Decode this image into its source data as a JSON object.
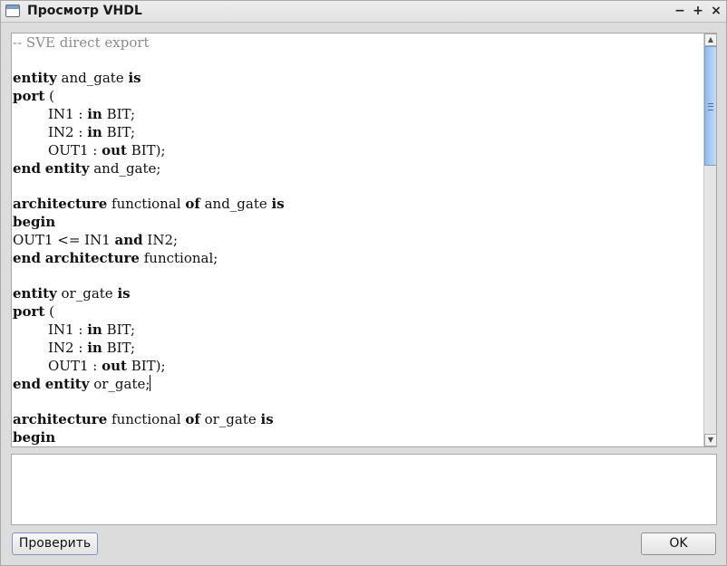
{
  "window": {
    "title": "Просмотр VHDL",
    "controls": {
      "minimize": "−",
      "maximize": "+",
      "close": "×"
    }
  },
  "editor": {
    "comment": "-- SVE direct export",
    "entity1": {
      "kw_entity": "entity",
      "name": "and_gate",
      "kw_is": "is"
    },
    "port1": {
      "kw_port": "port",
      "paren": " (",
      "lines": [
        {
          "sig": "IN1 : ",
          "kw": "in",
          "type": " BIT;"
        },
        {
          "sig": "IN2 : ",
          "kw": "in",
          "type": " BIT;"
        },
        {
          "sig": "OUT1 : ",
          "kw": "out",
          "type": " BIT);"
        }
      ]
    },
    "end_entity1": {
      "kw_end": "end",
      "kw_entity": "entity",
      "name": "and_gate;"
    },
    "arch1": {
      "kw_arch": "architecture",
      "name": "functional",
      "kw_of": "of",
      "target": "and_gate",
      "kw_is": "is"
    },
    "begin1": "begin",
    "assign1": {
      "lhs": "OUT1 <= IN1 ",
      "op": "and",
      "rhs": " IN2;"
    },
    "end_arch1": {
      "kw_end": "end",
      "kw_arch": "architecture",
      "name": "functional;"
    },
    "entity2": {
      "kw_entity": "entity",
      "name": "or_gate",
      "kw_is": "is"
    },
    "port2": {
      "kw_port": "port",
      "paren": " (",
      "lines": [
        {
          "sig": "IN1 : ",
          "kw": "in",
          "type": " BIT;"
        },
        {
          "sig": "IN2 : ",
          "kw": "in",
          "type": " BIT;"
        },
        {
          "sig": "OUT1 : ",
          "kw": "out",
          "type": " BIT);"
        }
      ]
    },
    "end_entity2": {
      "kw_end": "end",
      "kw_entity": "entity",
      "name": "or_gate;"
    },
    "arch2": {
      "kw_arch": "architecture",
      "name": "functional",
      "kw_of": "of",
      "target": "or_gate",
      "kw_is": "is"
    },
    "begin2": "begin",
    "scroll_position": 0.0
  },
  "output_text": "",
  "buttons": {
    "check": "Проверить",
    "ok": "OK"
  },
  "colors": {
    "comment": "#8c8c8c",
    "scroll_thumb": "#8ebbf0"
  },
  "icons": {
    "app": "window-icon",
    "scroll_up": "arrow-up-icon",
    "scroll_down": "arrow-down-icon"
  }
}
